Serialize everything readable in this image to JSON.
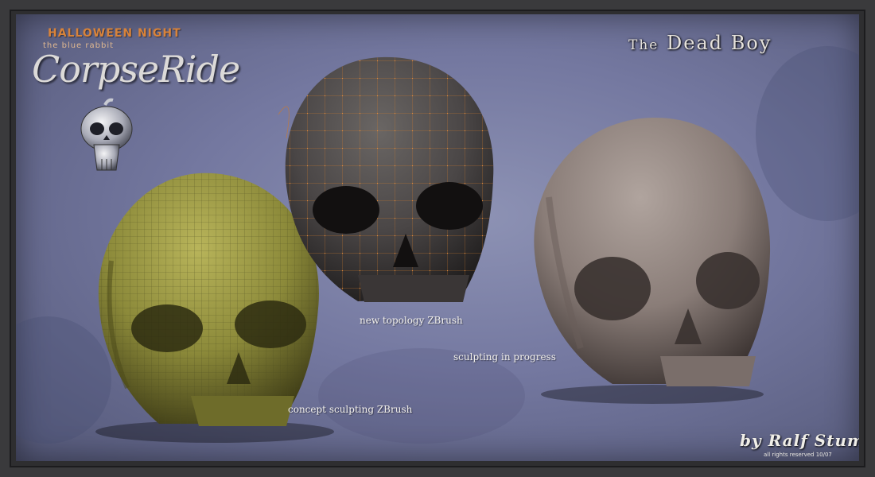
{
  "logo": {
    "top_line": "HALLOWEEN NIGHT",
    "sub_line": "the blue rabbit",
    "main": "CorpseRide"
  },
  "title": {
    "the": "The",
    "name": "Dead Boy"
  },
  "labels": {
    "concept": "concept sculpting ZBrush",
    "topology": "new topology ZBrush",
    "progress": "sculpting in progress"
  },
  "credit": {
    "signature": "by Ralf Stumpf",
    "rights": "all rights reserved 10/07"
  },
  "colors": {
    "background": "#7a7fa6",
    "skull_olive": "#8c8a3a",
    "skull_dark": "#4a4646",
    "skull_grey": "#8a7d78",
    "wire_orange": "#d07a2a",
    "wire_dark": "#4a4a20",
    "logo_orange": "#d8833a"
  }
}
